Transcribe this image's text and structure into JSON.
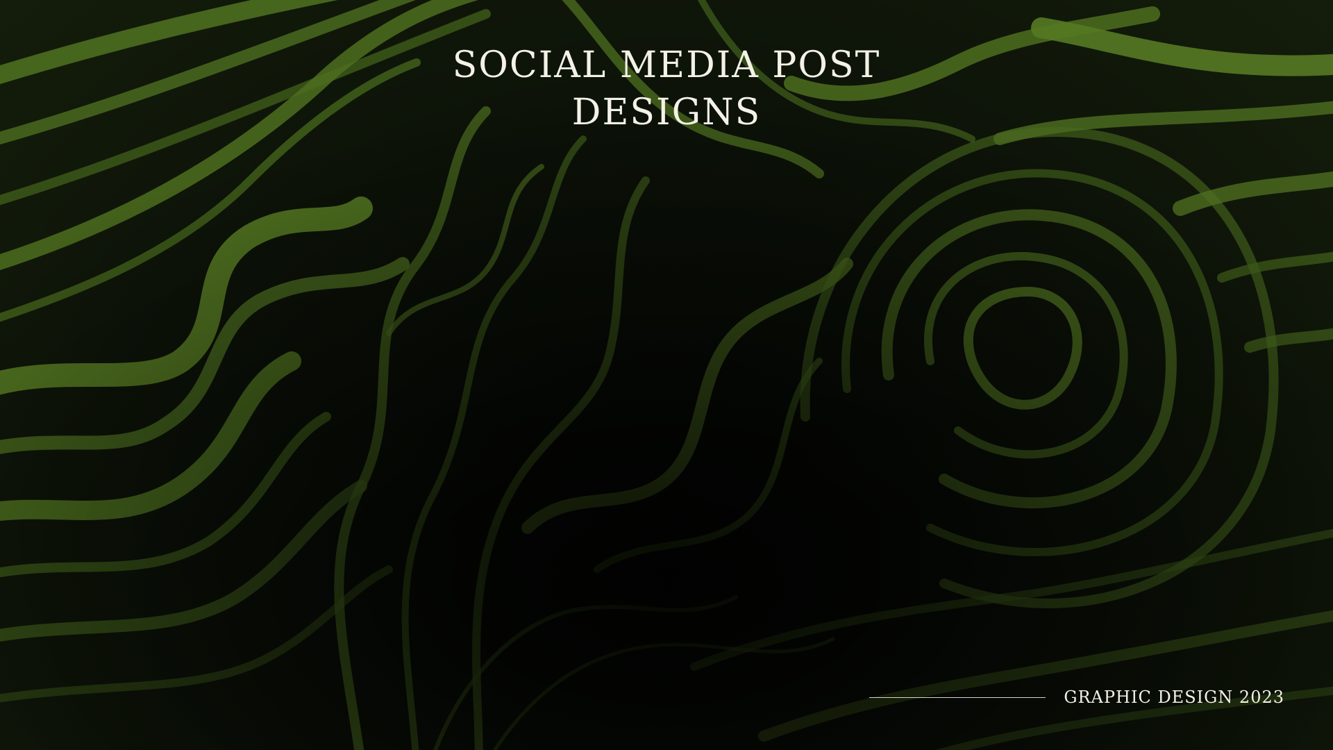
{
  "slide": {
    "title_line1": "SOCIAL MEDIA POST",
    "title_line2": "DESIGNS",
    "footer_text": "GRAPHIC DESIGN 2023"
  },
  "colors": {
    "background": "#0b0f07",
    "swirl_green": "#4a6a1e",
    "text": "#f4f1e6"
  }
}
